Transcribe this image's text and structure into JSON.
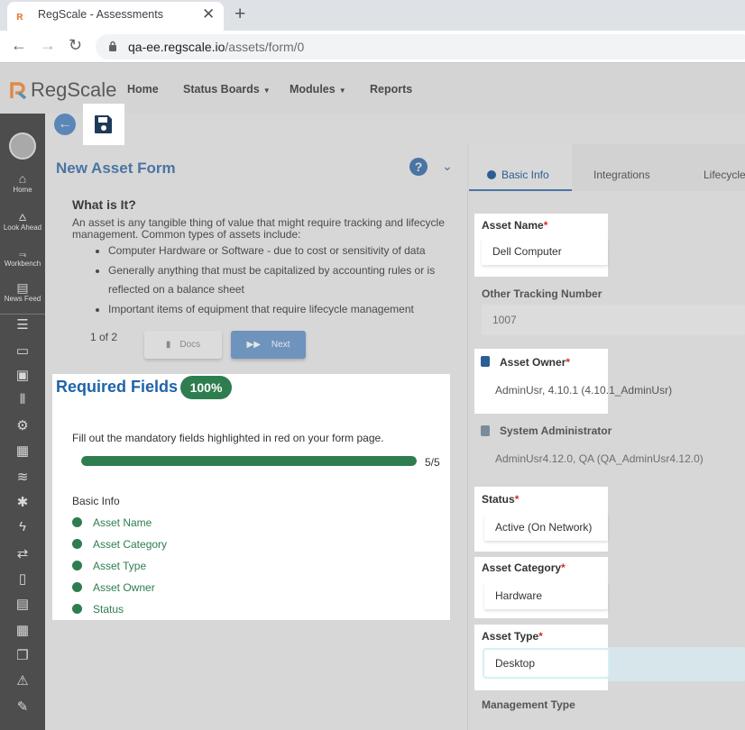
{
  "browser": {
    "tab_title": "RegScale - Assessments",
    "url_host": "qa-ee.regscale.io",
    "url_path": "/assets/form/0"
  },
  "app": {
    "logo_text": "RegScale",
    "nav": [
      {
        "label": "Home"
      },
      {
        "label": "Status Boards"
      },
      {
        "label": "Modules"
      },
      {
        "label": "Reports"
      }
    ]
  },
  "sidebar": {
    "labeled_items": [
      {
        "label": "Home",
        "icon": "home-icon"
      },
      {
        "label": "Look Ahead",
        "icon": "binoculars-icon"
      },
      {
        "label": "Workbench",
        "icon": "workbench-icon"
      },
      {
        "label": "News Feed",
        "icon": "newspaper-icon"
      }
    ]
  },
  "form": {
    "title": "New Asset Form",
    "what_title": "What is It?",
    "what_desc": "An asset is any tangible thing of value that might require tracking and lifecycle management. Common types of assets include:",
    "bullets": [
      "Computer Hardware or Software - due to cost or sensitivity of data",
      "Generally anything that must be capitalized by accounting rules or is reflected on a balance sheet",
      "Important items of equipment that require lifecycle management"
    ],
    "pager": "1 of 2",
    "docs_label": "Docs",
    "next_label": "Next"
  },
  "required": {
    "title": "Required Fields",
    "badge": "100%",
    "desc": "Fill out the mandatory fields highlighted in red on your form page.",
    "progress": 1.0,
    "count": "5/5",
    "section": "Basic Info",
    "items": [
      "Asset Name",
      "Asset Category",
      "Asset Type",
      "Asset Owner",
      "Status"
    ]
  },
  "tabs": {
    "basic": "Basic Info",
    "integrations": "Integrations",
    "lifecycle": "Lifecycle"
  },
  "fields": {
    "asset_name_label": "Asset Name",
    "asset_name_value": "Dell Computer",
    "other_tracking_label": "Other Tracking Number",
    "other_tracking_value": "1007",
    "asset_owner_label": "Asset Owner",
    "asset_owner_value": "AdminUsr, 4.10.1 (4.10.1_AdminUsr)",
    "sysadmin_label": "System Administrator",
    "sysadmin_value": "AdminUsr4.12.0, QA (QA_AdminUsr4.12.0)",
    "status_label": "Status",
    "status_value": "Active (On Network)",
    "asset_category_label": "Asset Category",
    "asset_category_value": "Hardware",
    "asset_type_label": "Asset Type",
    "asset_type_value": "Desktop",
    "management_type_label": "Management Type"
  },
  "colors": {
    "accent": "#1f63a8",
    "success": "#2e7d4f",
    "required": "#d32f2f"
  }
}
